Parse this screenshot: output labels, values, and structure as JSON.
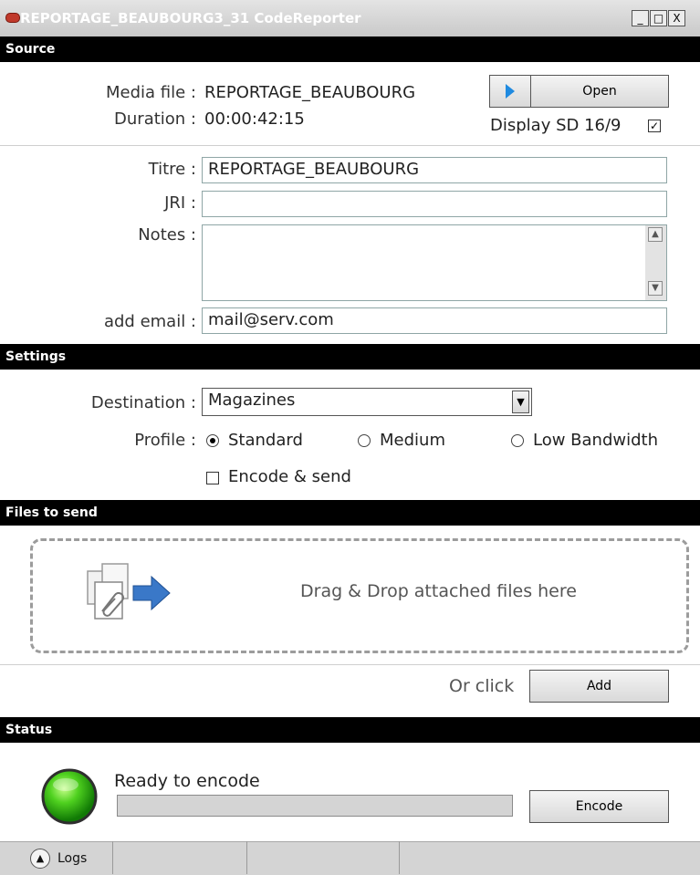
{
  "window": {
    "title": "REPORTAGE_BEAUBOURG3_31 CodeReporter",
    "minimize_glyph": "_",
    "maximize_glyph": "□",
    "close_glyph": "X"
  },
  "source": {
    "header": "Source",
    "media_file_label": "Media file :",
    "media_file_value": "REPORTAGE_BEAUBOURG",
    "duration_label": "Duration :",
    "duration_value": "00:00:42:15",
    "open_label": "Open",
    "display_label": "Display SD 16/9",
    "display_checked_glyph": "✓"
  },
  "metadata": {
    "titre_label": "Titre :",
    "titre_value": "REPORTAGE_BEAUBOURG",
    "jri_label": "JRI :",
    "jri_value": "",
    "notes_label": "Notes :",
    "notes_value": "",
    "email_label": "add email :",
    "email_value": "mail@serv.com"
  },
  "settings": {
    "header": "Settings",
    "destination_label": "Destination :",
    "destination_value": "Magazines",
    "profile_label": "Profile :",
    "profiles": [
      "Standard",
      "Medium",
      "Low Bandwidth"
    ],
    "encode_send_label": "Encode & send"
  },
  "files": {
    "header": "Files to send",
    "drop_text": "Drag & Drop attached files here",
    "or_click": "Or click",
    "add_label": "Add"
  },
  "status": {
    "header": "Status",
    "status_text": "Ready to encode",
    "encode_label": "Encode",
    "progress": 0
  },
  "statusbar": {
    "logs_label": "Logs"
  }
}
